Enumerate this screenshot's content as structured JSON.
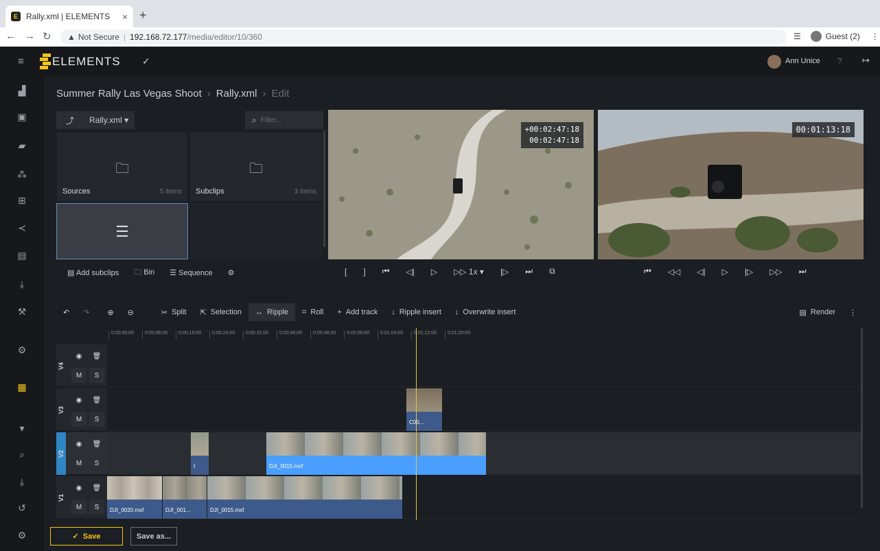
{
  "browser": {
    "tab_title": "Rally.xml | ELEMENTS",
    "tab_close": "×",
    "new_tab": "+",
    "security": "Not Secure",
    "url_host": "192.168.72.177",
    "url_path": "/media/editor/10/360",
    "profile": "Guest (2)"
  },
  "app": {
    "logo": "ELEMENTS",
    "user": "Ann Unice",
    "help": "?"
  },
  "breadcrumb": {
    "project": "Summer Rally Las Vegas Shoot",
    "file": "Rally.xml",
    "mode": "Edit"
  },
  "bin": {
    "selector": "Rally.xml",
    "filter_placeholder": "Filter...",
    "folders": [
      {
        "name": "Sources",
        "count": "5 items"
      },
      {
        "name": "Subclips",
        "count": "3 items"
      }
    ],
    "actions": {
      "add_subclips": "Add subclips",
      "bin": "Bin",
      "sequence": "Sequence"
    }
  },
  "source_viewer": {
    "tc1": "+00:02:47:18",
    "tc2": "00:02:47:18",
    "speed": "1x"
  },
  "program_viewer": {
    "tc": "00:01:13:18"
  },
  "timeline": {
    "tools": {
      "split": "Split",
      "selection": "Selection",
      "ripple": "Ripple",
      "roll": "Roll",
      "add_track": "Add track",
      "ripple_insert": "Ripple insert",
      "overwrite_insert": "Overwrite insert",
      "render": "Render"
    },
    "ruler": [
      "0:00:00:00",
      "0:00:08:00",
      "0:00:16:00",
      "0:00:24:00",
      "0:00:32:00",
      "0:00:40:00",
      "0:00:48:00",
      "0:00:56:00",
      "0:01:04:00",
      "0:01:12:00",
      "0:01:20:00"
    ],
    "tracks": [
      {
        "name": "V4",
        "m": "M",
        "s": "S"
      },
      {
        "name": "V3",
        "m": "M",
        "s": "S"
      },
      {
        "name": "V2",
        "m": "M",
        "s": "S"
      },
      {
        "name": "V1",
        "m": "M",
        "s": "S"
      }
    ],
    "clips": {
      "v3_a": "C00...",
      "v2_a": "I",
      "v2_b": "DJI_0015.mxf",
      "v1_a": "DJI_0020.mxf",
      "v1_b": "DJI_001...",
      "v1_c": "DJI_0015.mxf"
    }
  },
  "footer": {
    "save": "Save",
    "save_as": "Save as..."
  },
  "colors": {
    "accent": "#f5c518",
    "clip_blue": "#3d5a8a",
    "clip_selected": "#4a9eff",
    "playhead": "#e8c64a"
  }
}
